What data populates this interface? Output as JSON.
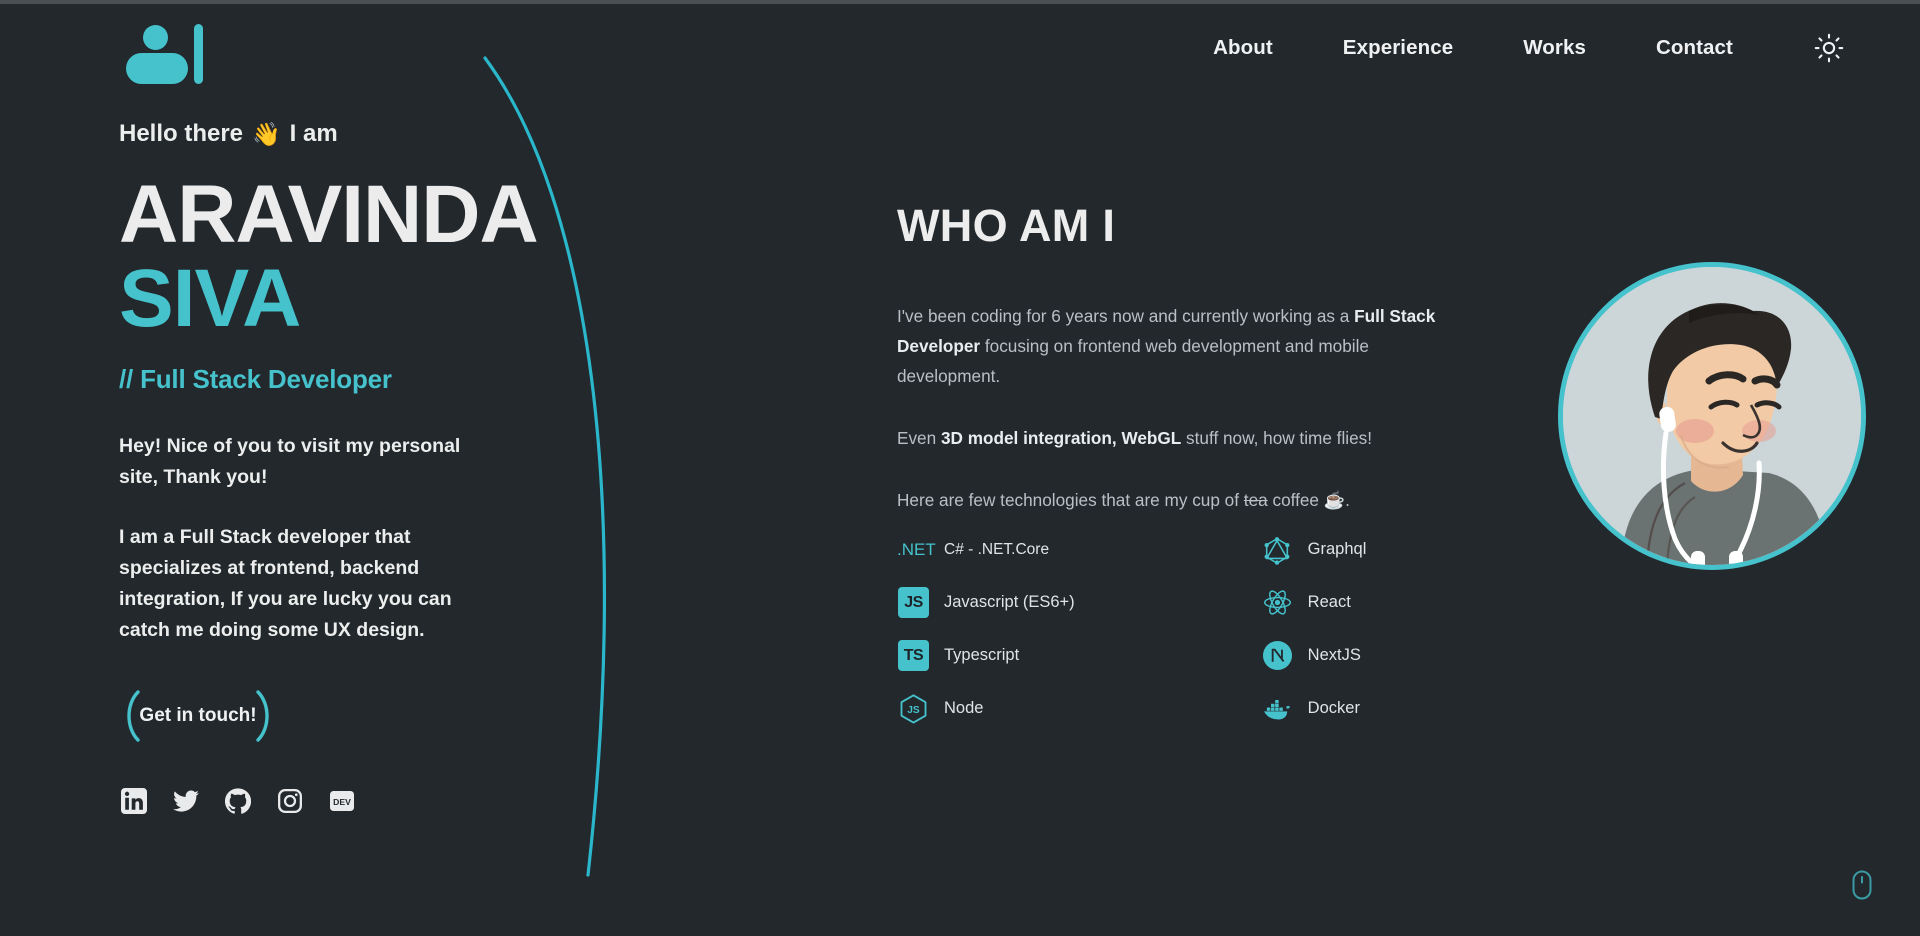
{
  "theme": {
    "background": "#22282c",
    "accent": "#45c2cb",
    "text_primary": "#ececec",
    "text_muted": "#b8c0c6"
  },
  "header": {
    "logo_name": "aravinda-logo",
    "nav": [
      {
        "label": "About"
      },
      {
        "label": "Experience"
      },
      {
        "label": "Works"
      },
      {
        "label": "Contact"
      }
    ],
    "theme_toggle_icon": "sun-icon"
  },
  "hero": {
    "greeting_before": "Hello there",
    "greeting_emoji": "👋",
    "greeting_after": "I am",
    "first_name": "ARAVINDA",
    "last_name": "SIVA",
    "role": "// Full Stack Developer",
    "paragraph_1": "Hey! Nice of you to visit my personal site, Thank you!",
    "paragraph_2": "I am a Full Stack developer that specializes at frontend, backend integration, If you are lucky you can catch me doing some UX design.",
    "cta_label": "Get in touch!",
    "socials": [
      {
        "name": "linkedin",
        "label": "LinkedIn"
      },
      {
        "name": "twitter",
        "label": "Twitter"
      },
      {
        "name": "github",
        "label": "GitHub"
      },
      {
        "name": "instagram",
        "label": "Instagram"
      },
      {
        "name": "devto",
        "label": "DEV"
      }
    ]
  },
  "who": {
    "title": "WHO AM I",
    "p1_a": "I've been coding for 6 years now and currently working as a ",
    "p1_b": "Full Stack Developer",
    "p1_c": " focusing on frontend web development and mobile development.",
    "p2_a": "Even ",
    "p2_b": "3D model integration, WebGL",
    "p2_c": " stuff now, how time flies!",
    "p3_a": "Here are few technologies that are my cup of ",
    "p3_strike": "tea",
    "p3_b": " coffee ",
    "p3_emoji": "☕",
    "p3_c": "."
  },
  "tech": {
    "left_column": [
      {
        "icon": "dotnet-icon",
        "icon_text": ".NET",
        "label": "C# - .NET.Core"
      },
      {
        "icon": "javascript-icon",
        "icon_text": "JS",
        "label": "Javascript (ES6+)"
      },
      {
        "icon": "typescript-icon",
        "icon_text": "TS",
        "label": "Typescript"
      },
      {
        "icon": "nodejs-icon",
        "icon_text": "",
        "label": "Node"
      }
    ],
    "right_column": [
      {
        "icon": "graphql-icon",
        "label": "Graphql"
      },
      {
        "icon": "react-icon",
        "label": "React"
      },
      {
        "icon": "nextjs-icon",
        "label": "NextJS"
      },
      {
        "icon": "docker-icon",
        "label": "Docker"
      }
    ]
  },
  "avatar": {
    "name": "profile-avatar",
    "alt": "Illustrated portrait of a person wearing earbuds and a gray hoodie"
  },
  "footer": {
    "scroll_hint_icon": "mouse-scroll-icon"
  }
}
